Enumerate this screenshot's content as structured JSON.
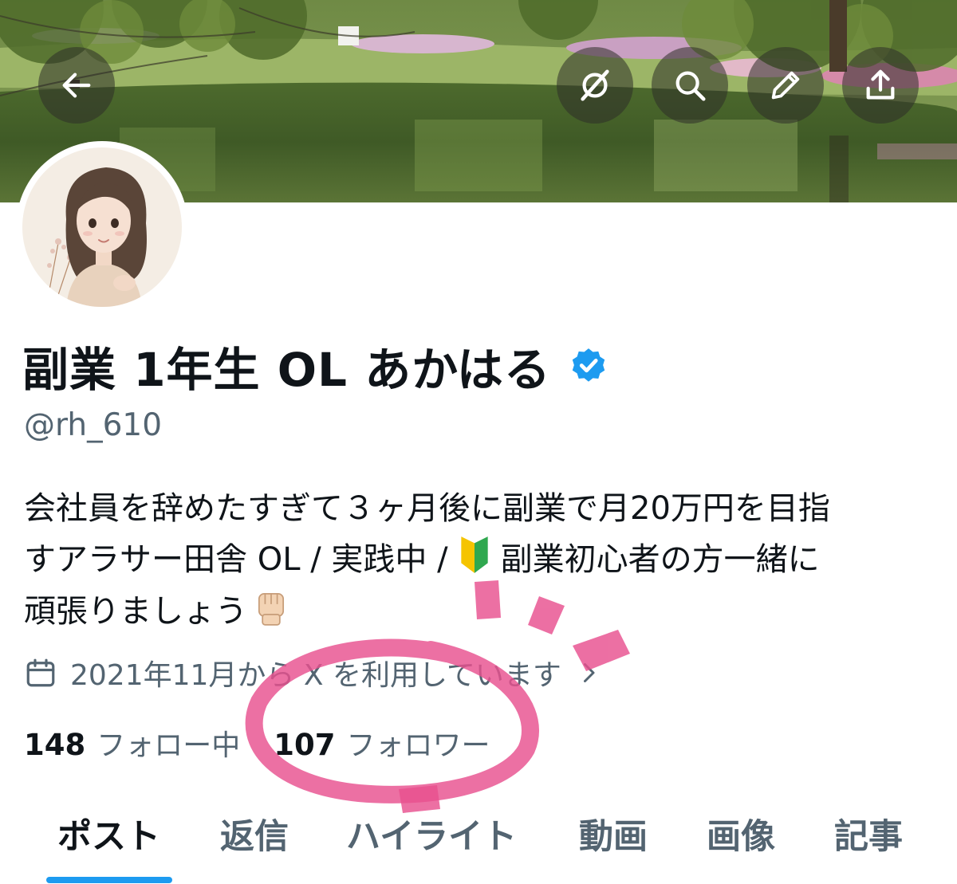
{
  "nav": {
    "back_icon": "arrow-left-icon",
    "grok_icon": "grok-icon",
    "search_icon": "search-icon",
    "edit_icon": "pencil-icon",
    "share_icon": "share-icon"
  },
  "profile": {
    "display_name": "副業 1年生 OL あかはる",
    "verified_badge_color": "#1d9bf0",
    "handle": "@rh_610",
    "bio_line1": "会社員を辞めたすぎて３ヶ月後に副業で月20万円を目指",
    "bio_line2_a": "すアラサー田舎 OL / 実践中 /",
    "bio_line2_emoji": "🔰",
    "bio_line2_b": "副業初心者の方一緒に",
    "bio_line3": "頑張りましょう",
    "bio_line3_emoji": "✊",
    "joined": "2021年11月から X を利用しています"
  },
  "stats": {
    "following_count": "148",
    "following_label": "フォロー中",
    "followers_count": "107",
    "followers_label": "フォロワー"
  },
  "tabs": [
    {
      "label": "ポスト",
      "active": true
    },
    {
      "label": "返信",
      "active": false
    },
    {
      "label": "ハイライト",
      "active": false
    },
    {
      "label": "動画",
      "active": false
    },
    {
      "label": "画像",
      "active": false
    },
    {
      "label": "記事",
      "active": false
    }
  ],
  "colors": {
    "accent": "#1d9bf0",
    "annotation": "#e8508f",
    "secondary_text": "#536471"
  }
}
